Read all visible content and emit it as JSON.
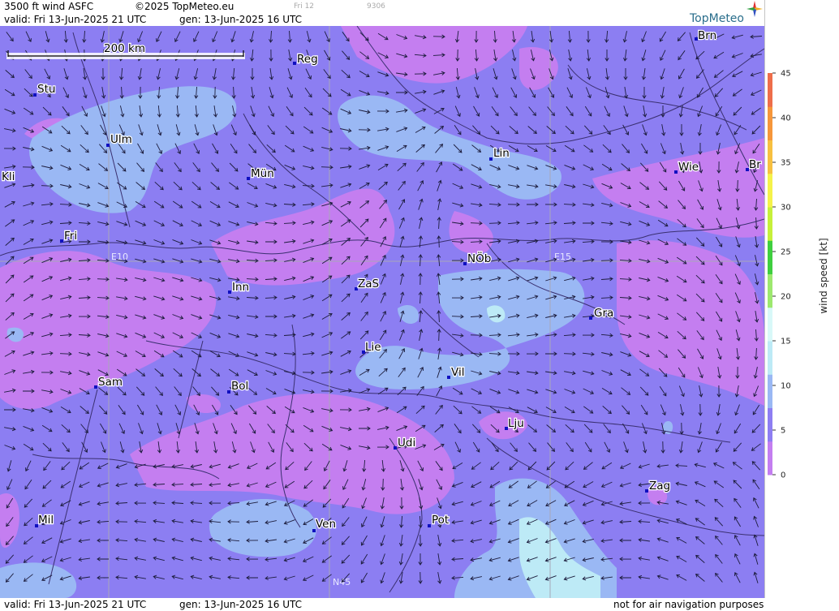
{
  "header": {
    "product": "3500 ft wind ASFC",
    "copyright": "©2025 TopMeteo.eu",
    "day_code": "Fri 12",
    "run_code": "9306",
    "valid": "valid:  Fri  13-Jun-2025  21 UTC",
    "generated": "gen: 13-Jun-2025 16 UTC",
    "brand": "TopMeteo"
  },
  "footer": {
    "valid": "valid:  Fri  13-Jun-2025  21 UTC",
    "generated": "gen: 13-Jun-2025 16 UTC",
    "disclaimer": "not for air navigation purposes"
  },
  "map": {
    "scale_label": "200 km",
    "grid_labels": [
      "E10",
      "E15",
      "N45"
    ],
    "cities": [
      {
        "name": "Brn"
      },
      {
        "name": "Reg"
      },
      {
        "name": "Stu"
      },
      {
        "name": "Ulm"
      },
      {
        "name": "Lin"
      },
      {
        "name": "Kli"
      },
      {
        "name": "Mün"
      },
      {
        "name": "Wie"
      },
      {
        "name": "Br"
      },
      {
        "name": "Fri"
      },
      {
        "name": "NÖb"
      },
      {
        "name": "Inn"
      },
      {
        "name": "ZaS"
      },
      {
        "name": "Gra"
      },
      {
        "name": "Lie"
      },
      {
        "name": "Vil"
      },
      {
        "name": "Sam"
      },
      {
        "name": "Bol"
      },
      {
        "name": "Lju"
      },
      {
        "name": "Udi"
      },
      {
        "name": "Zag"
      },
      {
        "name": "Mil"
      },
      {
        "name": "Pot"
      },
      {
        "name": "Ven"
      }
    ]
  },
  "legend": {
    "title": "wind speed [kt]",
    "ticks": [
      "45",
      "40",
      "35",
      "30",
      "25",
      "20",
      "15",
      "10",
      "5",
      "0"
    ],
    "colors": [
      "#c47ef0",
      "#8e7ef2",
      "#9ab8f4",
      "#bdeaf6",
      "#d8f8f8",
      "#9de86f",
      "#3fcf3f",
      "#c6f03a",
      "#f5f24a",
      "#f7c040",
      "#f6963a",
      "#ee6e4a"
    ]
  }
}
